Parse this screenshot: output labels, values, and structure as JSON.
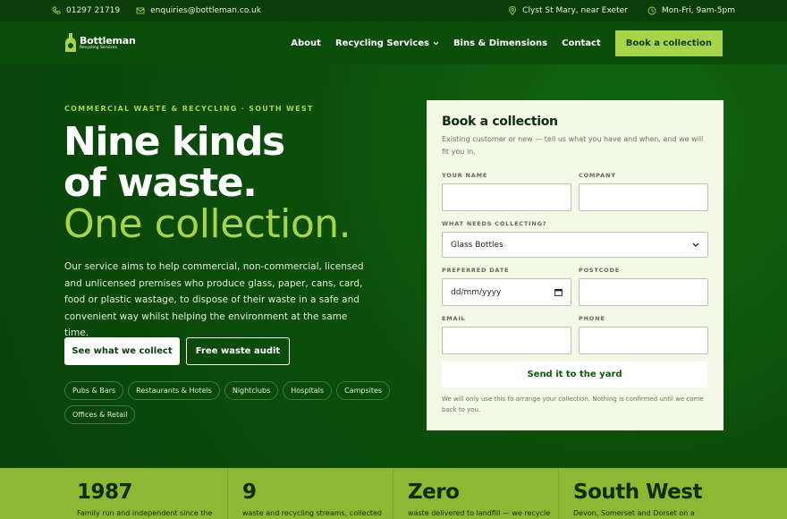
{
  "topbar": {
    "phone": "01297 21719",
    "email": "enquiries@bottleman.co.uk",
    "location": "Clyst St Mary, near Exeter",
    "hours": "Mon-Fri, 9am-5pm"
  },
  "brand": {
    "name": "Bottleman",
    "tagline": "Recycling Services"
  },
  "nav": {
    "items": [
      "About",
      "Recycling Services",
      "Bins & Dimensions",
      "Contact"
    ],
    "cta": "Book a collection"
  },
  "hero": {
    "eyebrow": "COMMERCIAL WASTE & RECYCLING · SOUTH WEST",
    "line1": "Nine kinds",
    "line2": "of waste.",
    "line3": "One collection.",
    "lede": "Our service aims to help commercial, non-commercial, licensed and unlicensed premises who produce glass, paper, cans, card, food or plastic wastage, to dispose of their waste in a safe and convenient way whilst helping the environment at the same time.",
    "primary_button": "See what we collect",
    "secondary_button": "Free waste audit",
    "chips": [
      "Pubs & Bars",
      "Restaurants & Hotels",
      "Nightclubs",
      "Hospitals",
      "Campsites",
      "Offices & Retail"
    ]
  },
  "form": {
    "title": "Book a collection",
    "subtitle": "Existing customer or new — tell us what you have and when, and we will fit you in.",
    "labels": {
      "name": "YOUR NAME",
      "company": "COMPANY",
      "collecting": "WHAT NEEDS COLLECTING?",
      "date": "PREFERRED DATE",
      "postcode": "POSTCODE",
      "email": "EMAIL",
      "phone": "PHONE"
    },
    "collecting_value": "Glass Bottles",
    "date_placeholder": "dd/mm/yyyy",
    "submit": "Send it to the yard",
    "note": "We will only use this to arrange your collection. Nothing is confirmed until we come back to you."
  },
  "stats": [
    {
      "big": "1987",
      "small": "Family run and independent since the"
    },
    {
      "big": "9",
      "small": "waste and recycling streams, collected"
    },
    {
      "big": "Zero",
      "small": "waste delivered to landfill — we recycle"
    },
    {
      "big": "South West",
      "small": "Devon, Somerset and Dorset on a"
    }
  ],
  "colors": {
    "dark_green": "#0b4a0b",
    "lime": "#a8d44a",
    "stats_bg": "#8cb834"
  }
}
